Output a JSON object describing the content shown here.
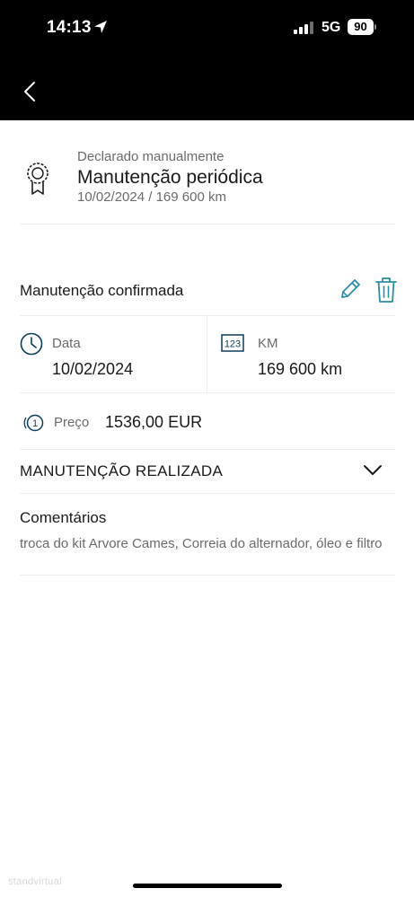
{
  "status_bar": {
    "time": "14:13",
    "network": "5G",
    "battery": "90"
  },
  "header": {
    "subtitle": "Declarado manualmente",
    "title": "Manutenção periódica",
    "meta": "10/02/2024 / 169 600 km"
  },
  "status": {
    "label": "Manutenção confirmada"
  },
  "details": {
    "date_label": "Data",
    "date_value": "10/02/2024",
    "km_label": "KM",
    "km_value": "169 600 km",
    "price_label": "Preço",
    "price_value": "1536,00 EUR"
  },
  "maintenance": {
    "label": "MANUTENÇÃO REALIZADA"
  },
  "comments": {
    "title": "Comentários",
    "text": "troca do kit Arvore Cames, Correia do alternador, óleo e filtro"
  },
  "watermark": "standvirtual",
  "colors": {
    "accent": "#2b8fa3",
    "dark": "#0b3d5c",
    "bar": "#000000"
  },
  "icons": {
    "back": "chevron-left-icon",
    "medal": "medal-icon",
    "edit": "pencil-icon",
    "delete": "trash-icon",
    "date": "clock-icon",
    "km": "odometer-icon",
    "price": "coin-icon",
    "expand": "chevron-down-icon"
  }
}
